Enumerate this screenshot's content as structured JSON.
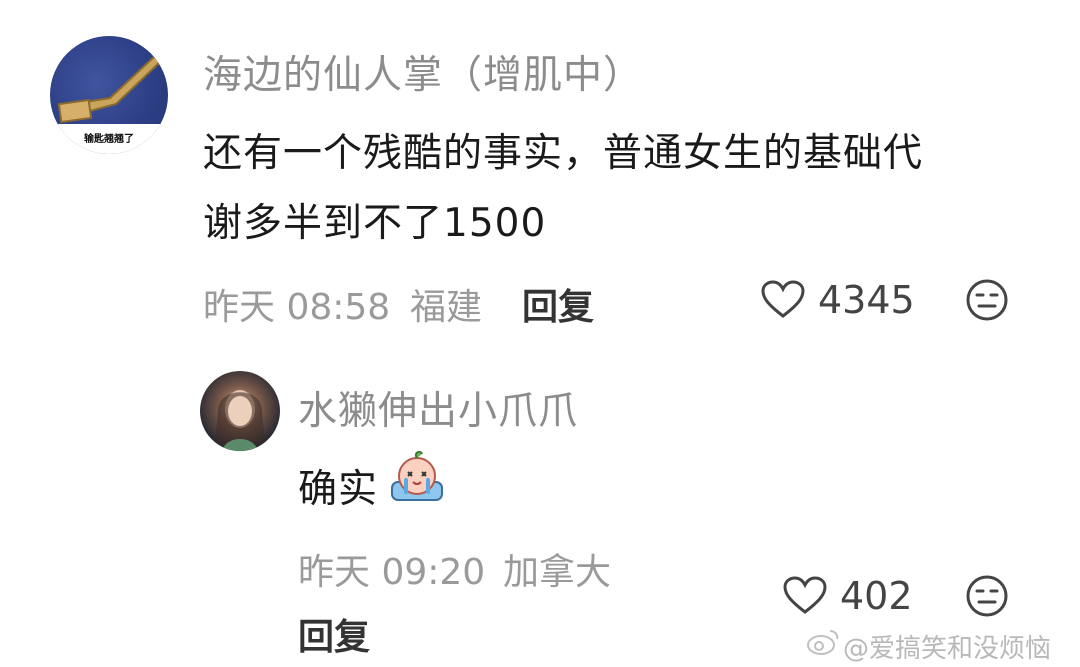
{
  "comments": [
    {
      "author": "海边的仙人掌（增肌中）",
      "avatar_caption": "输匙翘翘了",
      "text_line1": "还有一个残酷的事实，普通女生的基础代",
      "text_line2": "谢多半到不了1500",
      "time": "昨天 08:58",
      "location": "福建",
      "reply_label": "回复",
      "likes": "4345",
      "icons": [
        "heart-outline-icon",
        "neutral-face-icon"
      ]
    },
    {
      "author": "水獭伸出小爪爪",
      "text": "确实",
      "emoji": "crying-peach-emoji",
      "time": "昨天 09:20",
      "location": "加拿大",
      "reply_label": "回复",
      "likes": "402",
      "icons": [
        "heart-outline-icon",
        "neutral-face-icon"
      ]
    }
  ],
  "watermark": "@爱搞笑和没烦恼"
}
